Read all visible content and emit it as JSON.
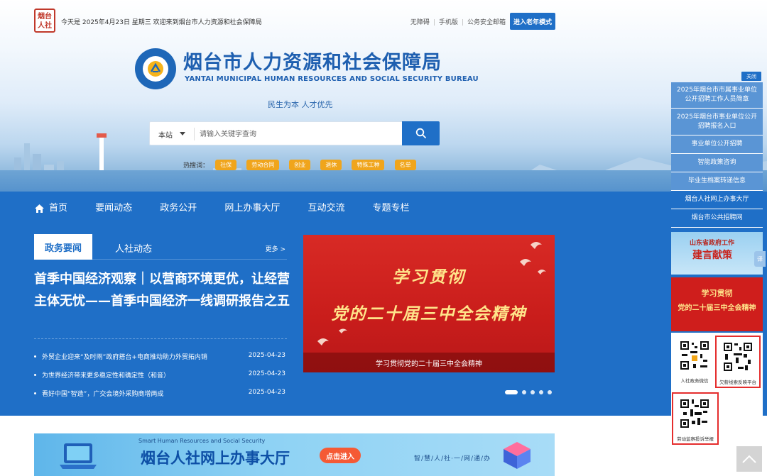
{
  "header": {
    "seal_text": "烟台\n人社",
    "date_text": "今天是 2025年4月23日 星期三 欢迎来到烟台市人力资源和社会保障局",
    "links": [
      "无障碍",
      "手机版",
      "公务安全邮箱"
    ],
    "elder_mode_label": "进入老年模式",
    "title": "烟台市人力资源和社会保障局",
    "subtitle": "YANTAI MUNICIPAL HUMAN RESOURCES AND SOCIAL SECURITY BUREAU",
    "slogan": "民生为本 人才优先"
  },
  "search": {
    "scope": "本站",
    "placeholder": "请输入关键字查询",
    "hot_label": "热搜词：",
    "hot_tags": [
      "社保",
      "劳动合同",
      "创业",
      "退休",
      "特殊工种",
      "名单"
    ]
  },
  "nav": {
    "items": [
      "首页",
      "要闻动态",
      "政务公开",
      "网上办事大厅",
      "互动交流",
      "专题专栏"
    ]
  },
  "news": {
    "tab_active": "政务要闻",
    "tab_other": "人社动态",
    "more": "更多 >",
    "headline": "首季中国经济观察｜以营商环境更优，让经营主体无忧——首季中国经济一线调研报告之五",
    "items": [
      {
        "title": "外贸企业迎来“及时雨”政府搭台+电商推动助力外贸拓内销",
        "date": "2025-04-23"
      },
      {
        "title": "为世界经济带来更多稳定性和确定性（和音）",
        "date": "2025-04-23"
      },
      {
        "title": "看好中国“智造”，广交会境外采购商增两成",
        "date": "2025-04-23"
      }
    ]
  },
  "feature": {
    "line1": "学习贯彻",
    "line2": "党的二十届三中全会精神",
    "caption": "学习贯彻党的二十届三中全会精神"
  },
  "portal_banner": {
    "subtitle": "Smart Human Resources and Social Security",
    "title": "烟台人社网上办事大厅",
    "enter_label": "点击进入",
    "tagline": "智/慧/人/社·一/网/通/办"
  },
  "sidebar": {
    "close_label": "关闭",
    "links": [
      "2025年烟台市市属事业单位公开招聘工作人员简章",
      "2025年烟台市事业单位公开招聘报名入口",
      "事业单位公开招聘",
      "智能政策咨询",
      "毕业生档案转递信息",
      "烟台人社网上办事大厅",
      "烟台市公共招聘网"
    ],
    "promo1_small": "山东省政府工作",
    "promo1_big": "建言献策",
    "promo2_line1": "学习贯彻",
    "promo2_line2": "党的二十届三中全会精神",
    "qr_codes": [
      "人社政务微信",
      "欠薪线索反映平台",
      "劳动监察投诉举报"
    ],
    "side_tab": "译"
  },
  "colors": {
    "primary_blue": "#1f6fc7",
    "hot_tag_orange": "#f0a51c",
    "feature_red": "#d82a25",
    "highlight_red_border": "#e52d2d"
  }
}
